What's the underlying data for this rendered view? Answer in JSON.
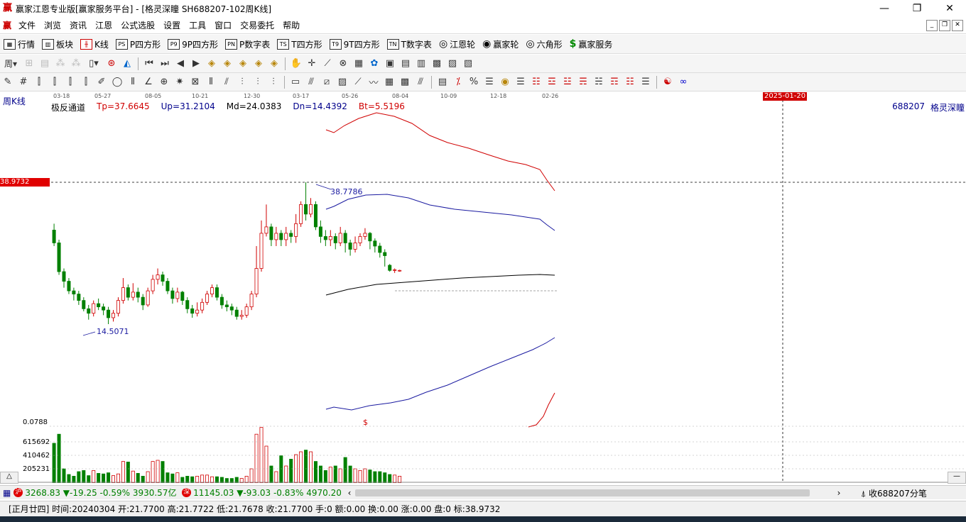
{
  "window": {
    "title": "赢家江恩专业版[赢家服务平台] - [格灵深瞳  SH688207-102周K线]",
    "minimize": "—",
    "restore": "❐",
    "close": "✕"
  },
  "menu": [
    "文件",
    "浏览",
    "资讯",
    "江恩",
    "公式选股",
    "设置",
    "工具",
    "窗口",
    "交易委托",
    "帮助"
  ],
  "toolbar1": [
    {
      "icon": "▦",
      "label": "行情"
    },
    {
      "icon": "▥",
      "label": "板块"
    },
    {
      "icon": "╫",
      "label": "K线"
    },
    {
      "icon": "PS",
      "label": "P四方形"
    },
    {
      "icon": "P9",
      "label": "9P四方形"
    },
    {
      "icon": "PN",
      "label": "P数字表"
    },
    {
      "icon": "TS",
      "label": "T四方形"
    },
    {
      "icon": "T9",
      "label": "9T四方形"
    },
    {
      "icon": "TN",
      "label": "T数字表"
    },
    {
      "icon": "◎",
      "label": "江恩轮"
    },
    {
      "icon": "◉",
      "label": "赢家轮"
    },
    {
      "icon": "◎",
      "label": "六角形"
    },
    {
      "icon": "$",
      "label": "赢家服务"
    }
  ],
  "toolbar2_first": "周",
  "chart": {
    "period_label": "周K线",
    "date_ticks": [
      "03-18",
      "05-27",
      "08-05",
      "10-21",
      "12-30",
      "03-17",
      "05-26",
      "08-04",
      "10-09",
      "12-18",
      "02-26"
    ],
    "cursor_date": "2025-01-20",
    "indicator_name": "极反通道",
    "tp": "Tp=37.6645",
    "up": "Up=31.2104",
    "md": "Md=24.0383",
    "dn": "Dn=14.4392",
    "bt": "Bt=5.5196",
    "symbol": "688207",
    "stock_name": "格灵深瞳",
    "price_marker": "38.9732",
    "high_label": "38.7786",
    "low_label": "14.5071",
    "volume_axis": [
      "0.0788",
      "615692",
      "410462",
      "205231"
    ],
    "dollar_mark": "$",
    "colors": {
      "up": "#d00000",
      "down": "#008000",
      "upper_band": "#d00000",
      "mid_band": "#1a1aa0",
      "lower_band": "#1a1aa0",
      "md_line": "#000000"
    }
  },
  "chart_data": {
    "type": "candlestick",
    "candles": [
      [
        31.5,
        29.5,
        32.5,
        29.0
      ],
      [
        29.5,
        25.0,
        30.0,
        24.5
      ],
      [
        25.0,
        23.5,
        25.5,
        22.5
      ],
      [
        23.5,
        22.0,
        24.0,
        21.5
      ],
      [
        22.0,
        21.5,
        22.5,
        20.5
      ],
      [
        21.5,
        20.5,
        22.0,
        19.8
      ],
      [
        20.5,
        19.2,
        21.0,
        18.8
      ],
      [
        19.2,
        18.5,
        19.8,
        17.5
      ],
      [
        18.5,
        20.0,
        20.5,
        18.0
      ],
      [
        20.0,
        19.5,
        20.8,
        19.0
      ],
      [
        19.5,
        19.0,
        20.0,
        18.2
      ],
      [
        19.0,
        17.8,
        19.5,
        16.8
      ],
      [
        17.8,
        18.5,
        19.0,
        17.2
      ],
      [
        18.5,
        20.5,
        21.0,
        18.0
      ],
      [
        20.5,
        22.5,
        24.0,
        20.0
      ],
      [
        22.5,
        21.0,
        23.0,
        20.5
      ],
      [
        21.0,
        21.8,
        23.2,
        20.5
      ],
      [
        21.8,
        21.0,
        22.5,
        20.2
      ],
      [
        21.0,
        19.8,
        21.5,
        19.0
      ],
      [
        19.8,
        22.0,
        22.5,
        19.5
      ],
      [
        22.0,
        23.8,
        24.5,
        21.5
      ],
      [
        23.8,
        24.5,
        25.5,
        23.0
      ],
      [
        24.5,
        23.5,
        25.0,
        22.8
      ],
      [
        23.5,
        22.0,
        24.0,
        21.5
      ],
      [
        22.0,
        20.8,
        22.5,
        20.0
      ],
      [
        20.8,
        21.8,
        22.5,
        20.2
      ],
      [
        21.8,
        20.5,
        22.0,
        19.8
      ],
      [
        20.5,
        19.2,
        21.0,
        18.5
      ],
      [
        19.2,
        18.5,
        19.8,
        17.8
      ],
      [
        18.5,
        19.0,
        20.2,
        18.0
      ],
      [
        19.0,
        20.2,
        20.8,
        18.5
      ],
      [
        20.2,
        21.5,
        22.0,
        19.8
      ],
      [
        21.5,
        22.5,
        23.0,
        21.0
      ],
      [
        22.5,
        21.0,
        23.0,
        20.5
      ],
      [
        21.0,
        19.8,
        21.5,
        19.2
      ],
      [
        19.8,
        19.5,
        20.5,
        18.8
      ],
      [
        19.5,
        19.0,
        20.0,
        18.2
      ],
      [
        19.0,
        18.0,
        19.5,
        17.5
      ],
      [
        18.0,
        18.2,
        19.0,
        17.5
      ],
      [
        18.2,
        19.5,
        20.0,
        17.8
      ],
      [
        19.5,
        21.5,
        22.0,
        19.0
      ],
      [
        21.5,
        25.5,
        29.0,
        21.0
      ],
      [
        25.5,
        31.0,
        33.0,
        25.0
      ],
      [
        31.0,
        32.0,
        35.5,
        30.5
      ],
      [
        32.0,
        30.0,
        32.5,
        29.0
      ],
      [
        30.0,
        31.0,
        32.0,
        29.0
      ],
      [
        31.0,
        30.0,
        31.5,
        29.0
      ],
      [
        30.0,
        31.0,
        32.0,
        29.0
      ],
      [
        31.0,
        30.5,
        31.5,
        29.5
      ],
      [
        30.5,
        32.5,
        34.0,
        29.5
      ],
      [
        32.5,
        35.5,
        36.0,
        32.0
      ],
      [
        35.5,
        34.0,
        38.97,
        33.0
      ],
      [
        34.0,
        35.5,
        36.5,
        33.5
      ],
      [
        35.5,
        32.0,
        36.0,
        31.5
      ],
      [
        32.0,
        30.5,
        33.0,
        29.5
      ],
      [
        30.5,
        30.0,
        31.5,
        29.0
      ],
      [
        30.0,
        30.5,
        31.5,
        29.0
      ],
      [
        30.5,
        29.5,
        31.0,
        28.5
      ],
      [
        29.5,
        31.0,
        32.0,
        29.0
      ],
      [
        31.0,
        29.5,
        31.5,
        28.0
      ],
      [
        29.5,
        28.5,
        30.0,
        27.5
      ],
      [
        28.5,
        29.5,
        30.5,
        28.0
      ],
      [
        29.5,
        30.5,
        31.0,
        29.0
      ],
      [
        30.5,
        31.0,
        31.8,
        30.0
      ],
      [
        31.0,
        29.8,
        31.2,
        28.5
      ],
      [
        29.8,
        29.0,
        30.2,
        28.0
      ],
      [
        29.0,
        28.0,
        29.5,
        27.2
      ],
      [
        28.0,
        27.5,
        28.5,
        25.8
      ],
      [
        26.0,
        25.2,
        26.2,
        25.0
      ],
      [
        25.2,
        25.3,
        25.5,
        24.8
      ],
      [
        25.2,
        25.2,
        25.3,
        25.0
      ]
    ],
    "volumes": [
      0.7,
      0.86,
      0.25,
      0.15,
      0.12,
      0.2,
      0.22,
      0.13,
      0.22,
      0.17,
      0.16,
      0.18,
      0.13,
      0.16,
      0.38,
      0.37,
      0.21,
      0.17,
      0.12,
      0.2,
      0.38,
      0.4,
      0.38,
      0.18,
      0.16,
      0.18,
      0.1,
      0.12,
      0.11,
      0.12,
      0.14,
      0.14,
      0.11,
      0.11,
      0.1,
      0.08,
      0.08,
      0.1,
      0.08,
      0.12,
      0.25,
      0.86,
      0.98,
      0.65,
      0.3,
      0.2,
      0.48,
      0.3,
      0.42,
      0.5,
      0.55,
      0.58,
      0.55,
      0.38,
      0.3,
      0.22,
      0.28,
      0.3,
      0.25,
      0.45,
      0.3,
      0.25,
      0.22,
      0.25,
      0.23,
      0.2,
      0.2,
      0.18,
      0.15,
      0.14,
      0.12
    ]
  },
  "status1": {
    "sh": "3268.83",
    "sh_change": "▼-19.25",
    "sh_pct": "-0.59%",
    "sh_amount": "3930.57亿",
    "sz": "11145.03",
    "sz_change": "▼-93.03",
    "sz_pct": "-0.83%",
    "sz_amount": "4970.20",
    "right_label": "收688207分笔"
  },
  "status2": {
    "text": "[正月廿四] 时间:20240304 开:21.7700 高:21.7722 低:21.7678 收:21.7700 手:0 额:0.00 换:0.00 涨:0.00 盘:0 标:38.9732"
  }
}
